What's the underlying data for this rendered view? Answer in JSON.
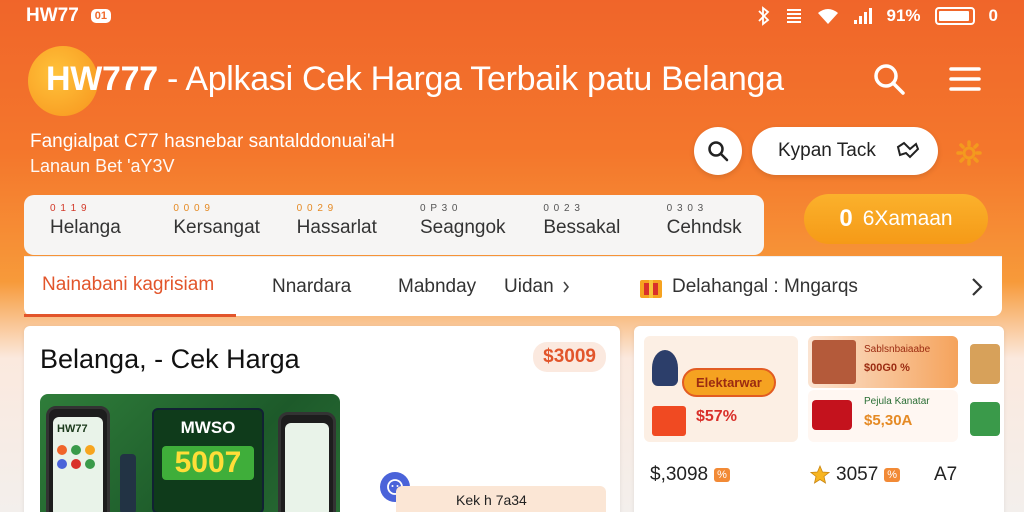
{
  "status_bar": {
    "time": "HW77",
    "badge": "01",
    "battery_text": "91%",
    "extra": "0"
  },
  "header": {
    "title_bold": "HW777",
    "title_rest": " - Aplkasi Cek Harga Terbaik  patu Belanga"
  },
  "subheader": {
    "line1": "Fangialpat C77 hasnebar santalddonuai'aH",
    "line2": "Lanaun Bet 'aY3V",
    "pill_label": "Kypan Tack"
  },
  "categories": [
    {
      "code": "0 1 1 9",
      "label": "Helanga",
      "code_color": "#d23a2a"
    },
    {
      "code": "0 0 0 9",
      "label": "Kersangat",
      "code_color": "#e58a24"
    },
    {
      "code": "0 0 2 9",
      "label": "Hassarlat",
      "code_color": "#e58a24"
    },
    {
      "code": "0 P 3 0",
      "label": "Seagngok",
      "code_color": "#555555"
    },
    {
      "code": "0 0 2 3",
      "label": "Bessakal",
      "code_color": "#555555"
    },
    {
      "code": "0 3 0 3",
      "label": "Cehndsk",
      "code_color": "#555555"
    }
  ],
  "cta": {
    "number": "0",
    "label": "6Xamaan"
  },
  "tabs": [
    {
      "label": "Nainabani kagrisiam",
      "active": true
    },
    {
      "label": "Nnardara"
    },
    {
      "label": "Mabnday"
    },
    {
      "label": "Uidan"
    },
    {
      "label": "Delahangal : Mngarqs"
    }
  ],
  "main_card": {
    "title": "Belanga, - Cek Harga",
    "price_chip": "$3009",
    "promo_brand": "MWSO",
    "promo_number": "5007",
    "phone_label": "HW77",
    "kek_text": "Kek h 7a34"
  },
  "product_card": {
    "promo1_label": "Elektarwar",
    "promo1_price": "$57%",
    "promo2_text": "Sablsnbaiaabe",
    "promo2_price": "$00G0 %",
    "promo3_text": "Pejula Kanatar",
    "promo3_price": "$5,30A",
    "prices": [
      {
        "value": "$,3098"
      },
      {
        "value": "3057"
      },
      {
        "value": "A7"
      }
    ]
  },
  "colors": {
    "brand_orange": "#f0652a",
    "accent_red": "#e2552b",
    "cta_yellow": "#f7a51f"
  }
}
